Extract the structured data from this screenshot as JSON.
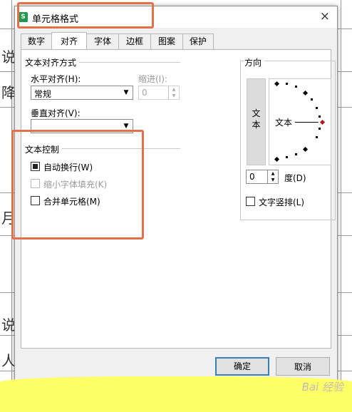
{
  "dialog": {
    "title": "单元格格式",
    "close_glyph": "×",
    "app_icon_glyph": "S"
  },
  "tabs": [
    {
      "label": "数字",
      "active": false
    },
    {
      "label": "对齐",
      "active": true
    },
    {
      "label": "字体",
      "active": false
    },
    {
      "label": "边框",
      "active": false
    },
    {
      "label": "图案",
      "active": false
    },
    {
      "label": "保护",
      "active": false
    }
  ],
  "alignment": {
    "group_title": "文本对齐方式",
    "horizontal_label": "水平对齐(H):",
    "horizontal_value": "常规",
    "indent_label": "缩进(I):",
    "indent_value": "0",
    "vertical_label": "垂直对齐(V):",
    "vertical_value": ""
  },
  "text_control": {
    "group_title": "文本控制",
    "wrap_label": "自动换行(W)",
    "wrap_checked": true,
    "shrink_label": "缩小字体填充(K)",
    "shrink_checked": false,
    "merge_label": "合并单元格(M)",
    "merge_checked": false
  },
  "orientation": {
    "group_title": "方向",
    "vertical_text_chars": [
      "文",
      "本"
    ],
    "dial_text": "文本",
    "degree_value": "0",
    "degree_label": "度(D)",
    "vertical_stack_label": "文字竖排(L)"
  },
  "buttons": {
    "ok": "确定",
    "cancel": "取消"
  },
  "background_sheet": {
    "cell_fragments": [
      "说",
      "降",
      "月",
      "说",
      "人"
    ]
  },
  "watermark": "Bai 经验",
  "colors": {
    "highlight": "#e2704b",
    "yellow_overlay": "#ffff66",
    "dial_marker": "#b01818"
  }
}
